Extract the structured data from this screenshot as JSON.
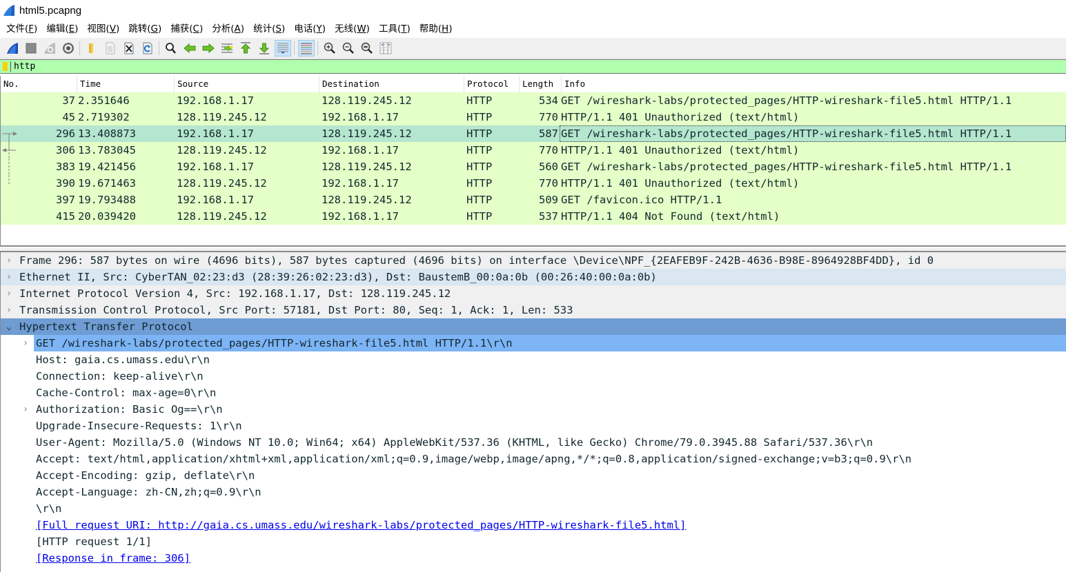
{
  "window": {
    "title": "html5.pcapng",
    "icon": "wireshark-fin-icon"
  },
  "menu": [
    {
      "label": "文件(",
      "acc": "F",
      "end": ")"
    },
    {
      "label": "编辑(",
      "acc": "E",
      "end": ")"
    },
    {
      "label": "视图(",
      "acc": "V",
      "end": ")"
    },
    {
      "label": "跳转(",
      "acc": "G",
      "end": ")"
    },
    {
      "label": "捕获(",
      "acc": "C",
      "end": ")"
    },
    {
      "label": "分析(",
      "acc": "A",
      "end": ")"
    },
    {
      "label": "统计(",
      "acc": "S",
      "end": ")"
    },
    {
      "label": "电话(",
      "acc": "Y",
      "end": ")"
    },
    {
      "label": "无线(",
      "acc": "W",
      "end": ")"
    },
    {
      "label": "工具(",
      "acc": "T",
      "end": ")"
    },
    {
      "label": "帮助(",
      "acc": "H",
      "end": ")"
    }
  ],
  "toolbar": {
    "buttons": [
      "start-capture-icon",
      "stop-capture-icon",
      "restart-capture-icon",
      "capture-options-icon",
      "open-file-icon",
      "save-file-icon",
      "close-file-icon",
      "reload-file-icon",
      "find-packet-icon",
      "go-back-icon",
      "go-forward-icon",
      "go-to-packet-icon",
      "first-packet-icon",
      "last-packet-icon",
      "auto-scroll-icon",
      "colorize-icon",
      "zoom-in-icon",
      "zoom-out-icon",
      "normal-size-icon",
      "resize-columns-icon"
    ]
  },
  "filter": {
    "value": "http",
    "background": "#afffaf"
  },
  "packet_list": {
    "columns": [
      "No.",
      "Time",
      "Source",
      "Destination",
      "Protocol",
      "Length",
      "Info"
    ],
    "rows": [
      {
        "no": "37",
        "time": "2.351646",
        "src": "192.168.1.17",
        "dst": "128.119.245.12",
        "proto": "HTTP",
        "len": "534",
        "info": "GET /wireshark-labs/protected_pages/HTTP-wireshark-file5.html HTTP/1.1"
      },
      {
        "no": "45",
        "time": "2.719302",
        "src": "128.119.245.12",
        "dst": "192.168.1.17",
        "proto": "HTTP",
        "len": "770",
        "info": "HTTP/1.1 401 Unauthorized  (text/html)"
      },
      {
        "no": "296",
        "time": "13.408873",
        "src": "192.168.1.17",
        "dst": "128.119.245.12",
        "proto": "HTTP",
        "len": "587",
        "info": "GET /wireshark-labs/protected_pages/HTTP-wireshark-file5.html HTTP/1.1",
        "selected": true
      },
      {
        "no": "306",
        "time": "13.783045",
        "src": "128.119.245.12",
        "dst": "192.168.1.17",
        "proto": "HTTP",
        "len": "770",
        "info": "HTTP/1.1 401 Unauthorized  (text/html)"
      },
      {
        "no": "383",
        "time": "19.421456",
        "src": "192.168.1.17",
        "dst": "128.119.245.12",
        "proto": "HTTP",
        "len": "560",
        "info": "GET /wireshark-labs/protected_pages/HTTP-wireshark-file5.html HTTP/1.1"
      },
      {
        "no": "390",
        "time": "19.671463",
        "src": "128.119.245.12",
        "dst": "192.168.1.17",
        "proto": "HTTP",
        "len": "770",
        "info": "HTTP/1.1 401 Unauthorized  (text/html)"
      },
      {
        "no": "397",
        "time": "19.793488",
        "src": "192.168.1.17",
        "dst": "128.119.245.12",
        "proto": "HTTP",
        "len": "509",
        "info": "GET /favicon.ico HTTP/1.1"
      },
      {
        "no": "415",
        "time": "20.039420",
        "src": "128.119.245.12",
        "dst": "192.168.1.17",
        "proto": "HTTP",
        "len": "537",
        "info": "HTTP/1.1 404 Not Found  (text/html)"
      }
    ],
    "row_color": "#e4ffc7",
    "selected_color": "#b5e6cf"
  },
  "details": {
    "rows": [
      {
        "level": 0,
        "twisty": "›",
        "text": "Frame 296: 587 bytes on wire (4696 bits), 587 bytes captured (4696 bits) on interface \\Device\\NPF_{2EAFEB9F-242B-4636-B98E-8964928BF4DD}, id 0"
      },
      {
        "level": 0,
        "twisty": "›",
        "text": "Ethernet II, Src: CyberTAN_02:23:d3 (28:39:26:02:23:d3), Dst: BaustemB_00:0a:0b (00:26:40:00:0a:0b)",
        "alt": true
      },
      {
        "level": 0,
        "twisty": "›",
        "text": "Internet Protocol Version 4, Src: 192.168.1.17, Dst: 128.119.245.12"
      },
      {
        "level": 0,
        "twisty": "›",
        "text": "Transmission Control Protocol, Src Port: 57181, Dst Port: 80, Seq: 1, Ack: 1, Len: 533"
      },
      {
        "level": 0,
        "twisty": "⌄",
        "text": "Hypertext Transfer Protocol",
        "open": true
      },
      {
        "level": 1,
        "twisty": "›",
        "text": "GET /wireshark-labs/protected_pages/HTTP-wireshark-file5.html HTTP/1.1\\r\\n",
        "selected": true
      },
      {
        "level": 1,
        "twisty": "",
        "text": "Host: gaia.cs.umass.edu\\r\\n"
      },
      {
        "level": 1,
        "twisty": "",
        "text": "Connection: keep-alive\\r\\n"
      },
      {
        "level": 1,
        "twisty": "",
        "text": "Cache-Control: max-age=0\\r\\n"
      },
      {
        "level": 1,
        "twisty": "›",
        "text": "Authorization: Basic Og==\\r\\n"
      },
      {
        "level": 1,
        "twisty": "",
        "text": "Upgrade-Insecure-Requests: 1\\r\\n"
      },
      {
        "level": 1,
        "twisty": "",
        "text": "User-Agent: Mozilla/5.0 (Windows NT 10.0; Win64; x64) AppleWebKit/537.36 (KHTML, like Gecko) Chrome/79.0.3945.88 Safari/537.36\\r\\n"
      },
      {
        "level": 1,
        "twisty": "",
        "text": "Accept: text/html,application/xhtml+xml,application/xml;q=0.9,image/webp,image/apng,*/*;q=0.8,application/signed-exchange;v=b3;q=0.9\\r\\n"
      },
      {
        "level": 1,
        "twisty": "",
        "text": "Accept-Encoding: gzip, deflate\\r\\n"
      },
      {
        "level": 1,
        "twisty": "",
        "text": "Accept-Language: zh-CN,zh;q=0.9\\r\\n"
      },
      {
        "level": 1,
        "twisty": "",
        "text": "\\r\\n"
      },
      {
        "level": 1,
        "twisty": "",
        "text": "[Full request URI: http://gaia.cs.umass.edu/wireshark-labs/protected_pages/HTTP-wireshark-file5.html]",
        "link": true
      },
      {
        "level": 1,
        "twisty": "",
        "text": "[HTTP request 1/1]"
      },
      {
        "level": 1,
        "twisty": "",
        "text": "[Response in frame: 306]",
        "link": true
      }
    ]
  }
}
